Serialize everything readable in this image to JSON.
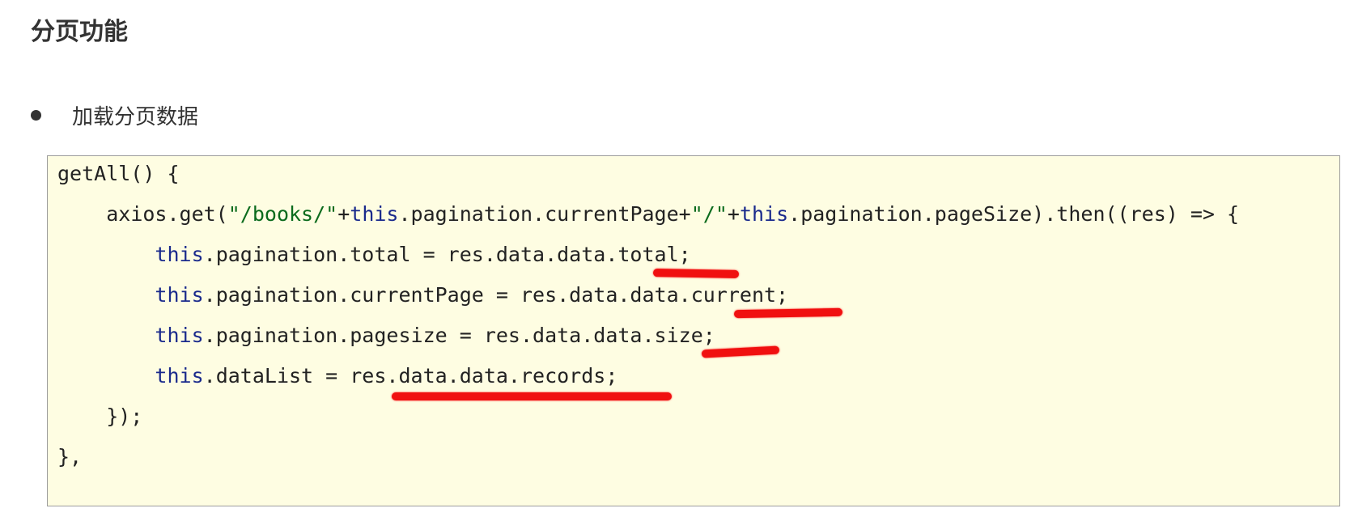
{
  "heading": "分页功能",
  "bullet": {
    "text": "加载分页数据"
  },
  "code": {
    "line1": "getAll() {",
    "line2": {
      "indent": "    ",
      "p1": "axios.get(",
      "s1": "\"/books/\"",
      "p2": "+",
      "k1": "this",
      "p3": ".pagination.currentPage+",
      "s2": "\"/\"",
      "p4": "+",
      "k2": "this",
      "p5": ".pagination.pageSize).then((res) => {"
    },
    "line3": {
      "indent": "        ",
      "kw": "this",
      "rest": ".pagination.total = res.data.data.total;"
    },
    "line4": {
      "indent": "        ",
      "kw": "this",
      "rest": ".pagination.currentPage = res.data.data.current;"
    },
    "line5": {
      "indent": "        ",
      "kw": "this",
      "rest": ".pagination.pagesize = res.data.data.size;"
    },
    "line6": {
      "indent": "        ",
      "kw": "this",
      "rest": ".dataList = res.data.data.records;"
    },
    "line7": "    });",
    "line8": "},"
  },
  "colors": {
    "code_background": "#fefde2",
    "keyword": "#1a2a8c",
    "string": "#0b6b1d",
    "highlight_mark": "#f01010"
  }
}
